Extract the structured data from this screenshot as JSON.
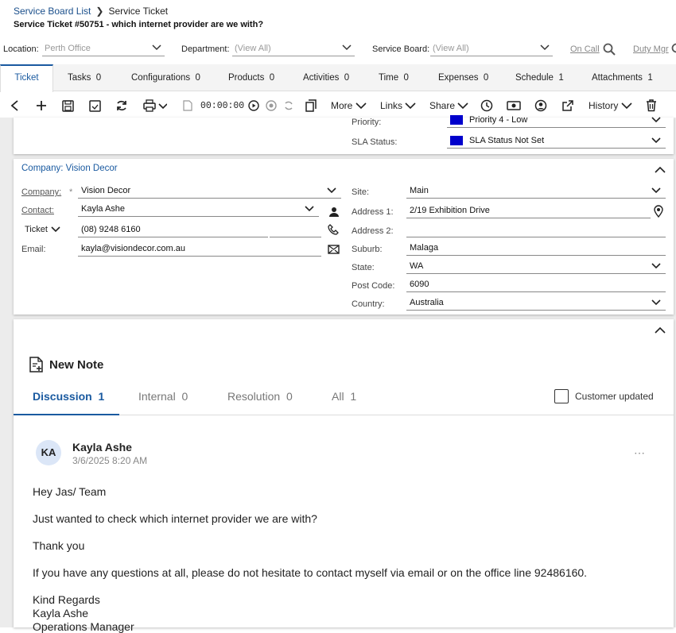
{
  "breadcrumb": {
    "root": "Service Board List",
    "current": "Service Ticket"
  },
  "title": "Service Ticket #50751 - which internet provider are we with?",
  "filters": {
    "location_label": "Location:",
    "location_value": "Perth Office",
    "department_label": "Department:",
    "department_value": "(View All)",
    "board_label": "Service Board:",
    "board_value": "(View All)",
    "on_call": "On Call",
    "duty_mgr": "Duty Mgr"
  },
  "tabs": [
    {
      "label": "Ticket",
      "count": ""
    },
    {
      "label": "Tasks",
      "count": "0"
    },
    {
      "label": "Configurations",
      "count": "0"
    },
    {
      "label": "Products",
      "count": "0"
    },
    {
      "label": "Activities",
      "count": "0"
    },
    {
      "label": "Time",
      "count": "0"
    },
    {
      "label": "Expenses",
      "count": "0"
    },
    {
      "label": "Schedule",
      "count": "1"
    },
    {
      "label": "Attachments",
      "count": "1"
    }
  ],
  "toolbar": {
    "timer": "00:00:00",
    "more": "More",
    "links": "Links",
    "share": "Share",
    "history": "History"
  },
  "priority": {
    "label": "Priority:",
    "value": "Priority 4 - Low",
    "color": "#0000cc"
  },
  "sla": {
    "label": "SLA Status:",
    "value": "SLA Status Not Set",
    "color": "#0000cc"
  },
  "company_section": {
    "header": "Company: Vision Decor",
    "company_label": "Company:",
    "company_value": "Vision Decor",
    "contact_label": "Contact:",
    "contact_value": "Kayla Ashe",
    "phone_type": "Ticket",
    "phone_value": "(08) 9248 6160",
    "email_label": "Email:",
    "email_value": "kayla@visiondecor.com.au",
    "site_label": "Site:",
    "site_value": "Main",
    "address1_label": "Address 1:",
    "address1_value": "2/19 Exhibition Drive",
    "address2_label": "Address 2:",
    "address2_value": "",
    "suburb_label": "Suburb:",
    "suburb_value": "Malaga",
    "state_label": "State:",
    "state_value": "WA",
    "postcode_label": "Post Code:",
    "postcode_value": "6090",
    "country_label": "Country:",
    "country_value": "Australia"
  },
  "notes": {
    "new_note": "New Note",
    "tabs": [
      {
        "label": "Discussion",
        "count": "1"
      },
      {
        "label": "Internal",
        "count": "0"
      },
      {
        "label": "Resolution",
        "count": "0"
      },
      {
        "label": "All",
        "count": "1"
      }
    ],
    "customer_updated": "Customer updated"
  },
  "note": {
    "initials": "KA",
    "author": "Kayla Ashe",
    "date": "3/6/2025 8:20 AM",
    "lines": [
      "Hey Jas/ Team",
      "Just wanted to check which internet provider we are with?",
      "Thank you",
      "If you have any questions at all, please do not hesitate to contact myself via email or on the office line 92486160.",
      "Kind Regards",
      "Kayla Ashe",
      "Operations Manager"
    ]
  }
}
